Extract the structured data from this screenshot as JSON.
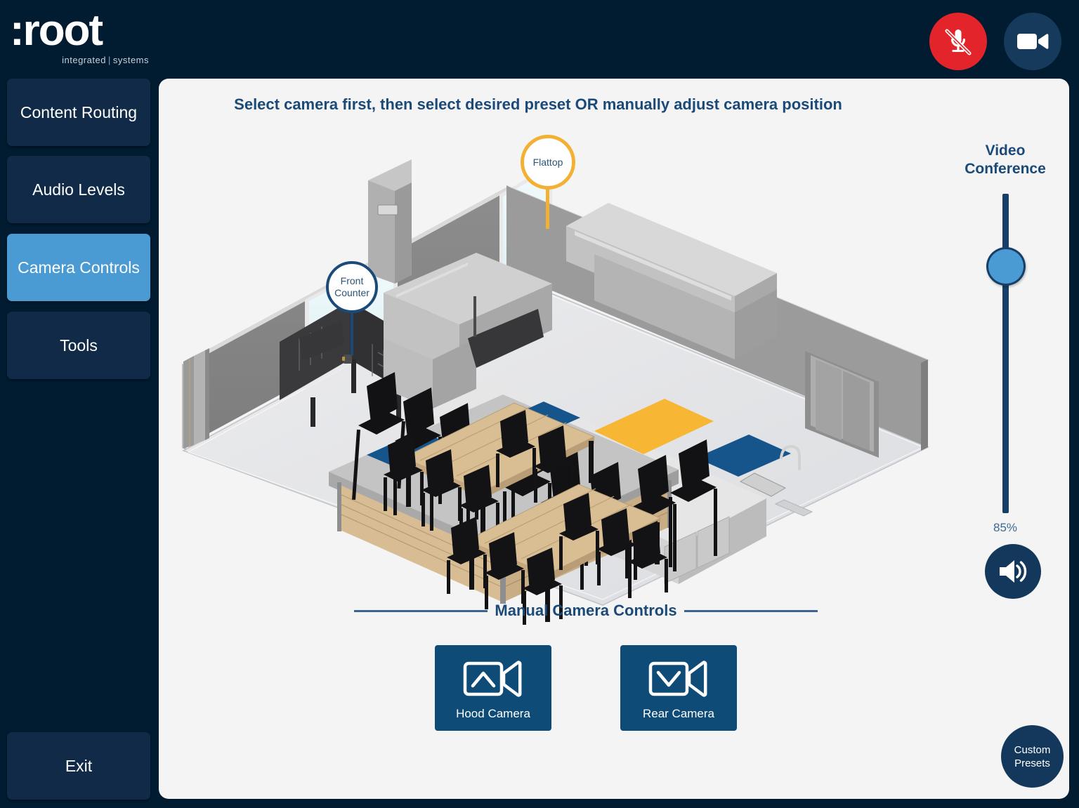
{
  "brand": {
    "name": ":root",
    "tagline_left": "integrated",
    "tagline_sep": "|",
    "tagline_right": "systems"
  },
  "topbar": {
    "mic_icon": "microphone-muted-icon",
    "mic_label": "Microphone Muted",
    "camera_icon": "video-camera-icon",
    "camera_label": "Camera"
  },
  "sidebar": {
    "items": [
      {
        "label": "Content Routing",
        "active": false
      },
      {
        "label": "Audio Levels",
        "active": false
      },
      {
        "label": "Camera Controls",
        "active": true
      },
      {
        "label": "Tools",
        "active": false
      }
    ],
    "exit_label": "Exit"
  },
  "main": {
    "instruction": "Select camera first, then select desired preset OR manually adjust camera position",
    "presets": [
      {
        "name": "Front Counter",
        "color": "#1b4a78",
        "selected": false
      },
      {
        "name": "Flattop",
        "color": "#f2b134",
        "selected": true
      }
    ],
    "manual_controls": {
      "title": "Manual Camera Controls",
      "buttons": [
        {
          "label": "Hood Camera",
          "icon": "camera-up-icon"
        },
        {
          "label": "Rear Camera",
          "icon": "camera-down-icon"
        }
      ]
    },
    "custom_presets": {
      "line1": "Custom",
      "line2": "Presets"
    }
  },
  "volume": {
    "title_line1": "Video",
    "title_line2": "Conference",
    "value": "85%",
    "percent": 85,
    "speaker_icon": "speaker-on-icon"
  },
  "colors": {
    "background": "#011b31",
    "panel": "#f4f4f5",
    "accent_blue": "#4a9bd4",
    "deep_blue": "#14385b",
    "text_blue": "#1b4a78",
    "mute_red": "#e3242b",
    "preset_yellow": "#f2b134"
  }
}
